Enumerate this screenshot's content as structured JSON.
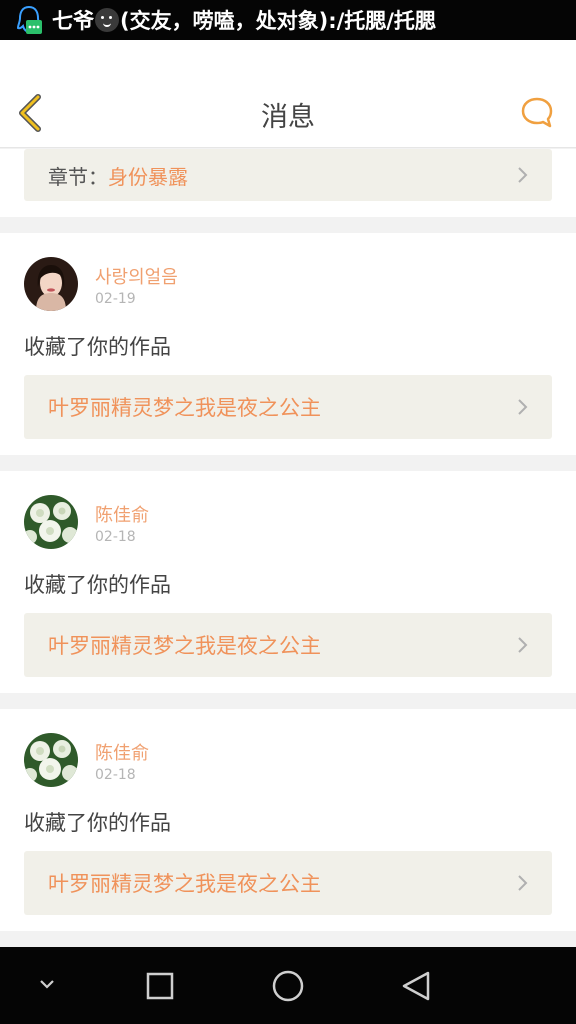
{
  "status_bar": {
    "app_icon": "qq-penguin-icon",
    "notif_before_emoji": "七爷",
    "emoji_icon": "smiley-face-icon",
    "notif_after_emoji": "(交友，唠嗑，处对象):/托腮/托腮"
  },
  "header": {
    "back_icon": "chevron-left-icon",
    "title": "消息",
    "chat_icon": "chat-bubble-icon",
    "accent_color": "#f0a040"
  },
  "chapter": {
    "label": "章节：",
    "value": "身份暴露"
  },
  "messages": [
    {
      "name": "사랑의얼음",
      "date": "02-19",
      "action": "收藏了你的作品",
      "work_title": "叶罗丽精灵梦之我是夜之公主",
      "avatar": "girl-portrait"
    },
    {
      "name": "陈佳俞",
      "date": "02-18",
      "action": "收藏了你的作品",
      "work_title": "叶罗丽精灵梦之我是夜之公主",
      "avatar": "white-flowers"
    },
    {
      "name": "陈佳俞",
      "date": "02-18",
      "action": "收藏了你的作品",
      "work_title": "叶罗丽精灵梦之我是夜之公主",
      "avatar": "white-flowers"
    }
  ],
  "nav_bar": {
    "icons": [
      "chevron-down-icon",
      "recents-square-icon",
      "home-circle-icon",
      "back-triangle-icon"
    ]
  },
  "colors": {
    "accent_orange": "#f0925a",
    "name_orange": "#f0a070",
    "box_bg": "#f1f0e9"
  }
}
